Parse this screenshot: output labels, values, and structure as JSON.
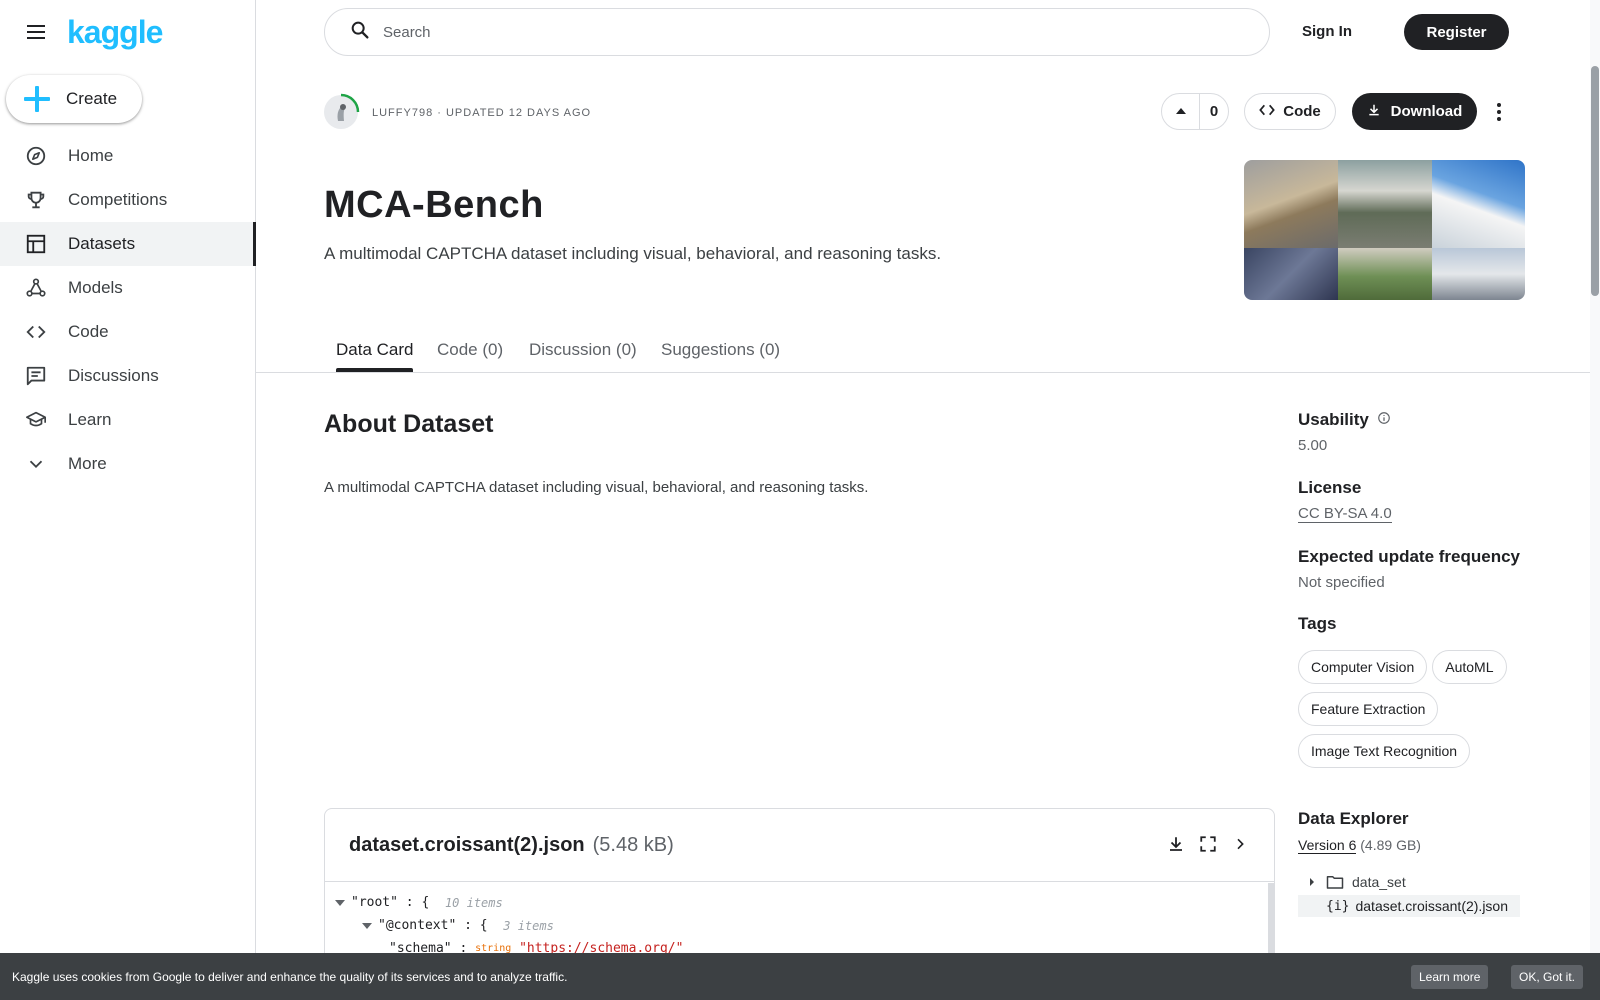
{
  "brand": {
    "logo": "kaggle",
    "accent": "#20beff"
  },
  "sidebar": {
    "create_label": "Create",
    "items": [
      {
        "label": "Home",
        "icon": "compass-icon"
      },
      {
        "label": "Competitions",
        "icon": "trophy-icon"
      },
      {
        "label": "Datasets",
        "icon": "table-icon",
        "active": true
      },
      {
        "label": "Models",
        "icon": "models-icon"
      },
      {
        "label": "Code",
        "icon": "code-icon"
      },
      {
        "label": "Discussions",
        "icon": "comments-icon"
      },
      {
        "label": "Learn",
        "icon": "school-icon"
      },
      {
        "label": "More",
        "icon": "chevron-down-icon"
      }
    ]
  },
  "topbar": {
    "search_placeholder": "Search",
    "sign_in": "Sign In",
    "register": "Register"
  },
  "dataset": {
    "byline": "LUFFY798 · UPDATED 12 DAYS AGO",
    "upvotes": "0",
    "code_label": "Code",
    "download_label": "Download",
    "title": "MCA-Bench",
    "subtitle": "A multimodal CAPTCHA dataset including visual, behavioral, and reasoning tasks."
  },
  "tabs": [
    {
      "label": "Data Card",
      "active": true
    },
    {
      "label": "Code (0)"
    },
    {
      "label": "Discussion (0)"
    },
    {
      "label": "Suggestions (0)"
    }
  ],
  "about": {
    "heading": "About Dataset",
    "body": "A multimodal CAPTCHA dataset including visual, behavioral, and reasoning tasks."
  },
  "meta": {
    "usability_label": "Usability",
    "usability_value": "5.00",
    "license_label": "License",
    "license_value": "CC BY-SA 4.0",
    "frequency_label": "Expected update frequency",
    "frequency_value": "Not specified",
    "tags_label": "Tags",
    "tags": [
      "Computer Vision",
      "AutoML",
      "Feature Extraction",
      "Image Text Recognition"
    ]
  },
  "explorer": {
    "heading": "Data Explorer",
    "version": "Version 6",
    "size": "(4.89 GB)",
    "tree": [
      {
        "label": "data_set",
        "kind": "folder"
      },
      {
        "label": "dataset.croissant(2).json",
        "kind": "json",
        "selected": true
      }
    ]
  },
  "viewer": {
    "file_name": "dataset.croissant(2).json",
    "file_size": "(5.48 kB)",
    "json_lines": [
      {
        "key": "\"root\"",
        "sep": " : {",
        "meta": "10 items"
      },
      {
        "key": "\"@context\"",
        "sep": " : {",
        "meta": "3 items"
      },
      {
        "key": "\"schema\"",
        "sep": " : ",
        "type": "string",
        "value": "\"https://schema.org/\""
      }
    ]
  },
  "cookie": {
    "text": "Kaggle uses cookies from Google to deliver and enhance the quality of its services and to analyze traffic.",
    "learn_more": "Learn more",
    "ok": "OK, Got it."
  }
}
